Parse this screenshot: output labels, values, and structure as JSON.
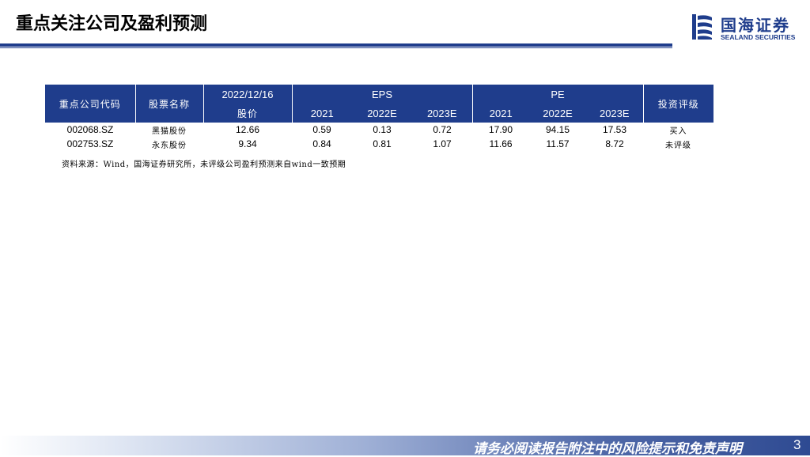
{
  "header": {
    "title": "重点关注公司及盈利预测",
    "logo_cn": "国海证券",
    "logo_en": "SEALAND SECURITIES"
  },
  "table": {
    "headers": {
      "code": "重点公司代码",
      "name": "股票名称",
      "date": "2022/12/16",
      "price": "股价",
      "eps": "EPS",
      "pe": "PE",
      "rating": "投资评级",
      "eps_years": [
        "2021",
        "2022E",
        "2023E"
      ],
      "pe_years": [
        "2021",
        "2022E",
        "2023E"
      ]
    },
    "rows": [
      {
        "code": "002068.SZ",
        "name": "黑猫股份",
        "price": "12.66",
        "eps": [
          "0.59",
          "0.13",
          "0.72"
        ],
        "pe": [
          "17.90",
          "94.15",
          "17.53"
        ],
        "rating": "买入"
      },
      {
        "code": "002753.SZ",
        "name": "永东股份",
        "price": "9.34",
        "eps": [
          "0.84",
          "0.81",
          "1.07"
        ],
        "pe": [
          "11.66",
          "11.57",
          "8.72"
        ],
        "rating": "未评级"
      }
    ]
  },
  "source_note": "资料来源：Wind，国海证券研究所，未评级公司盈利预测来自wind一致预期",
  "footer": {
    "disclaimer": "请务必阅读报告附注中的风险提示和免责声明",
    "page_number": "3"
  },
  "colors": {
    "brand": "#1f3d8c"
  }
}
